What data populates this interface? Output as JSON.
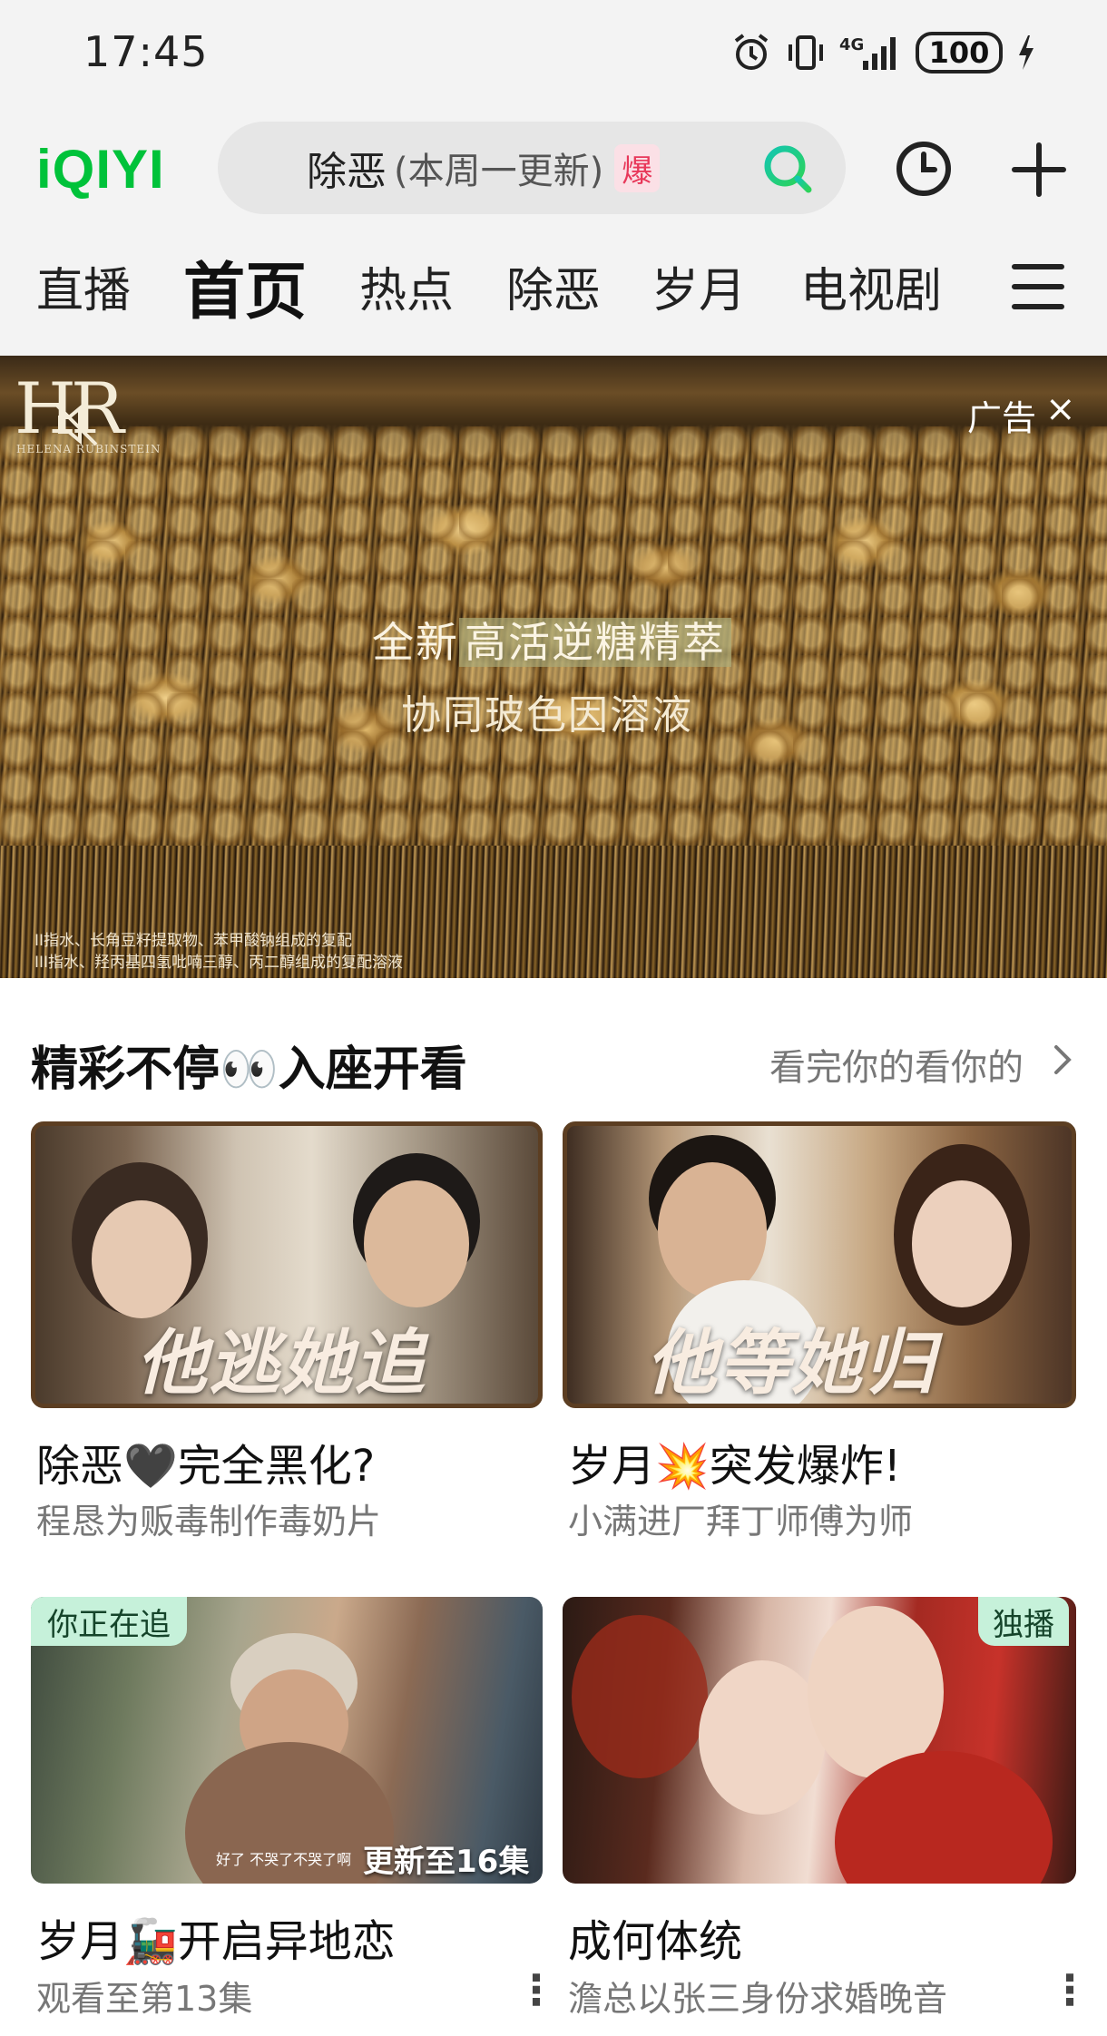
{
  "status_bar": {
    "time": "17:45",
    "network": "4G",
    "battery": "100"
  },
  "header": {
    "logo": "iQIYI",
    "search": {
      "query": "除恶",
      "note": "(本周一更新)",
      "badge": "爆"
    },
    "icons": [
      "search-icon",
      "history-icon",
      "plus-icon"
    ]
  },
  "nav": {
    "tabs": [
      {
        "label": "直播",
        "active": false
      },
      {
        "label": "首页",
        "active": true
      },
      {
        "label": "热点",
        "active": false
      },
      {
        "label": "除恶",
        "active": false
      },
      {
        "label": "岁月",
        "active": false
      },
      {
        "label": "电视剧",
        "active": false
      }
    ]
  },
  "ad": {
    "logo": "HR",
    "logo_sub": "HELENA RUBINSTEIN",
    "label": "广告",
    "close": "×",
    "line1_prefix": "全新",
    "line1_highlight": "高活逆糖精萃",
    "line2": "协同玻色因溶液",
    "fine_print_1": "II指水、长角豆籽提取物、苯甲酸钠组成的复配",
    "fine_print_2": "III指水、羟丙基四氢吡喃三醇、丙二醇组成的复配溶液"
  },
  "section": {
    "title": "精彩不停👀入座开看",
    "more": "看完你的看你的"
  },
  "cards": [
    {
      "overlay": "他逃她追",
      "title": "除恶🖤完全黑化?",
      "subtitle": "程恳为贩毒制作毒奶片"
    },
    {
      "overlay": "他等她归",
      "title": "岁月💥突发爆炸!",
      "subtitle": "小满进厂拜丁师傅为师"
    },
    {
      "badge": "你正在追",
      "update": "更新至16集",
      "caption": "好了 不哭了不哭了啊",
      "title": "岁月🚂开启异地恋",
      "subtitle": "观看至第13集"
    },
    {
      "badge": "独播",
      "title": "成何体统",
      "subtitle": "澹总以张三身份求婚晚音"
    }
  ],
  "colors": {
    "brand": "#00c23a",
    "badge_bg": "#c6f1da",
    "hot_badge": "#e8385a"
  }
}
